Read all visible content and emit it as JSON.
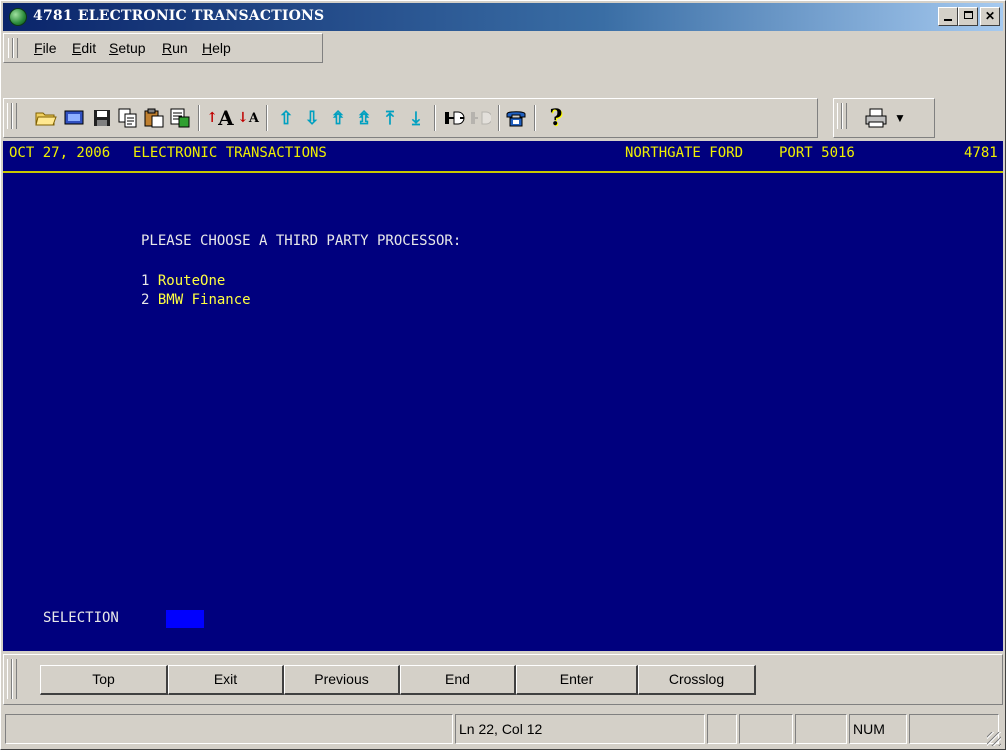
{
  "window": {
    "title": "4781 ELECTRONIC TRANSACTIONS"
  },
  "menu": {
    "items": [
      {
        "label": "File",
        "accel": "F",
        "rest": "ile"
      },
      {
        "label": "Edit",
        "accel": "E",
        "rest": "dit"
      },
      {
        "label": "Setup",
        "accel": "S",
        "rest": "etup"
      },
      {
        "label": "Run",
        "accel": "R",
        "rest": "un"
      },
      {
        "label": "Help",
        "accel": "H",
        "rest": "elp"
      }
    ]
  },
  "toolbar": {
    "icons": [
      "open-folder-icon",
      "screen-icon",
      "save-icon",
      "copy-icon",
      "paste-icon",
      "transfer-icon",
      "font-larger-icon",
      "font-smaller-icon",
      "arrow-up-icon",
      "arrow-down-icon",
      "page-up-icon",
      "page-down-icon",
      "top-icon",
      "bottom-icon",
      "connect-icon",
      "disconnect-icon",
      "phone-icon",
      "help-icon",
      "print-icon"
    ]
  },
  "terminal": {
    "header": {
      "date": "OCT 27, 2006",
      "screen": "ELECTRONIC TRANSACTIONS",
      "dealer": "NORTHGATE FORD",
      "port": "PORT 5016",
      "id": "4781"
    },
    "prompt": "PLEASE CHOOSE A THIRD PARTY PROCESSOR:",
    "options": [
      {
        "num": "1",
        "label": "RouteOne"
      },
      {
        "num": "2",
        "label": "BMW Finance"
      }
    ],
    "selection_label": "SELECTION",
    "selection_value": ""
  },
  "function_keys": [
    "Top",
    "Exit",
    "Previous",
    "End",
    "Enter",
    "Crosslog"
  ],
  "status": {
    "position": "Ln 22, Col 12",
    "num": "NUM"
  },
  "colors": {
    "terminal_bg": "#00007e",
    "header_text": "#f0f000",
    "option_text": "#ffff40",
    "input_field": "#0000ff"
  }
}
